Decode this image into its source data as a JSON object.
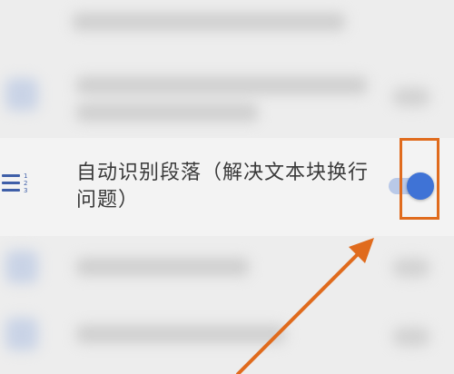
{
  "setting": {
    "label": "自动识别段落（解决文本块换行问题）",
    "toggle_state": "on",
    "icon": "list-numbered-icon"
  },
  "colors": {
    "toggle_thumb": "#3f73d6",
    "toggle_track": "#b9c9e8",
    "annotation": "#e06b1d"
  }
}
